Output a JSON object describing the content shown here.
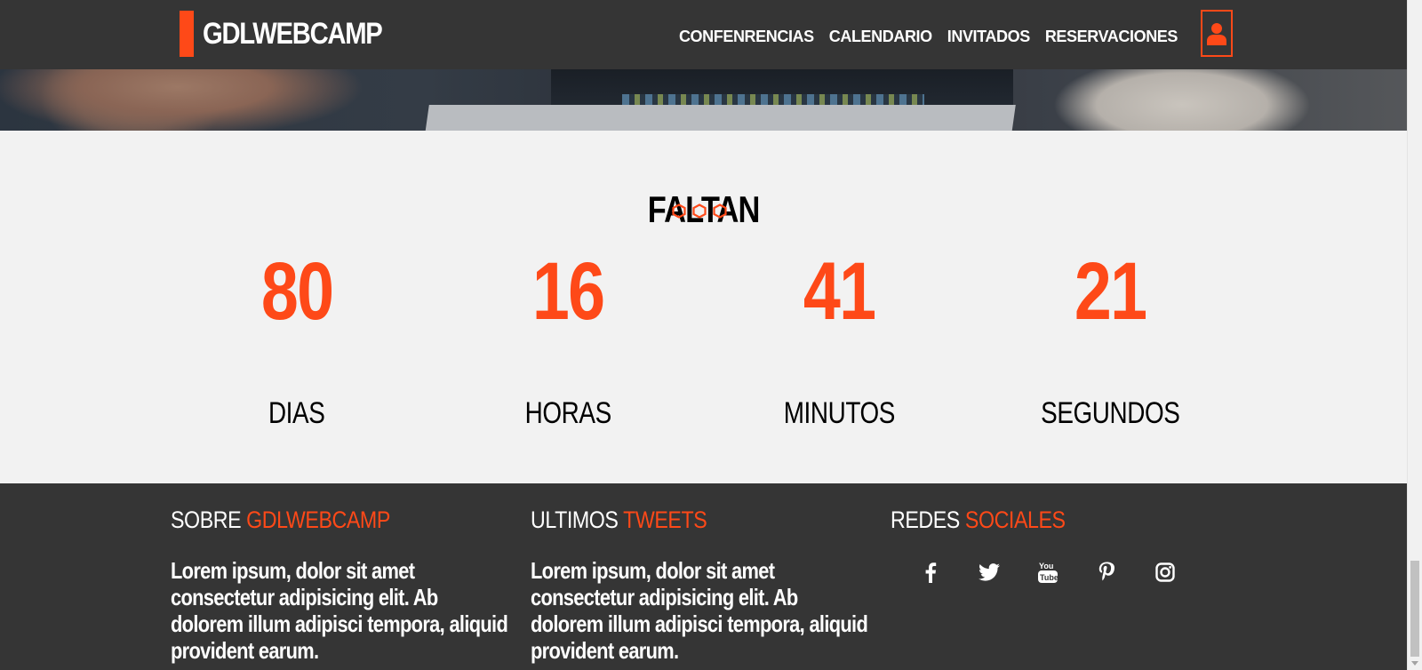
{
  "header": {
    "logo_text": "GDLWEBCAMP",
    "nav": [
      {
        "label": "CONFENRENCIAS"
      },
      {
        "label": "CALENDARIO"
      },
      {
        "label": "INVITADOS"
      },
      {
        "label": "RESERVACIONES"
      }
    ],
    "user_icon": "user-icon"
  },
  "countdown": {
    "title": "FALTAN",
    "items": [
      {
        "value": "80",
        "label": "DIAS"
      },
      {
        "value": "16",
        "label": "HORAS"
      },
      {
        "value": "41",
        "label": "MINUTOS"
      },
      {
        "value": "21",
        "label": "SEGUNDOS"
      }
    ]
  },
  "footer": {
    "about": {
      "heading_plain": "SOBRE",
      "heading_accent": "GDLWEBCAMP",
      "text": "Lorem ipsum, dolor sit amet consectetur adipisicing elit. Ab dolorem illum adipisci tempora, aliquid provident earum."
    },
    "tweets": {
      "heading_plain": "ULTIMOS",
      "heading_accent": "TWEETS",
      "text": "Lorem ipsum, dolor sit amet consectetur adipisicing elit. Ab dolorem illum adipisci tempora, aliquid provident earum."
    },
    "social": {
      "heading_plain": "REDES",
      "heading_accent": "SOCIALES",
      "icons": [
        "facebook-icon",
        "twitter-icon",
        "youtube-icon",
        "pinterest-icon",
        "instagram-icon"
      ]
    }
  },
  "colors": {
    "accent": "#fe4918",
    "dark": "#353535",
    "light_bg": "#f2f2f2"
  }
}
